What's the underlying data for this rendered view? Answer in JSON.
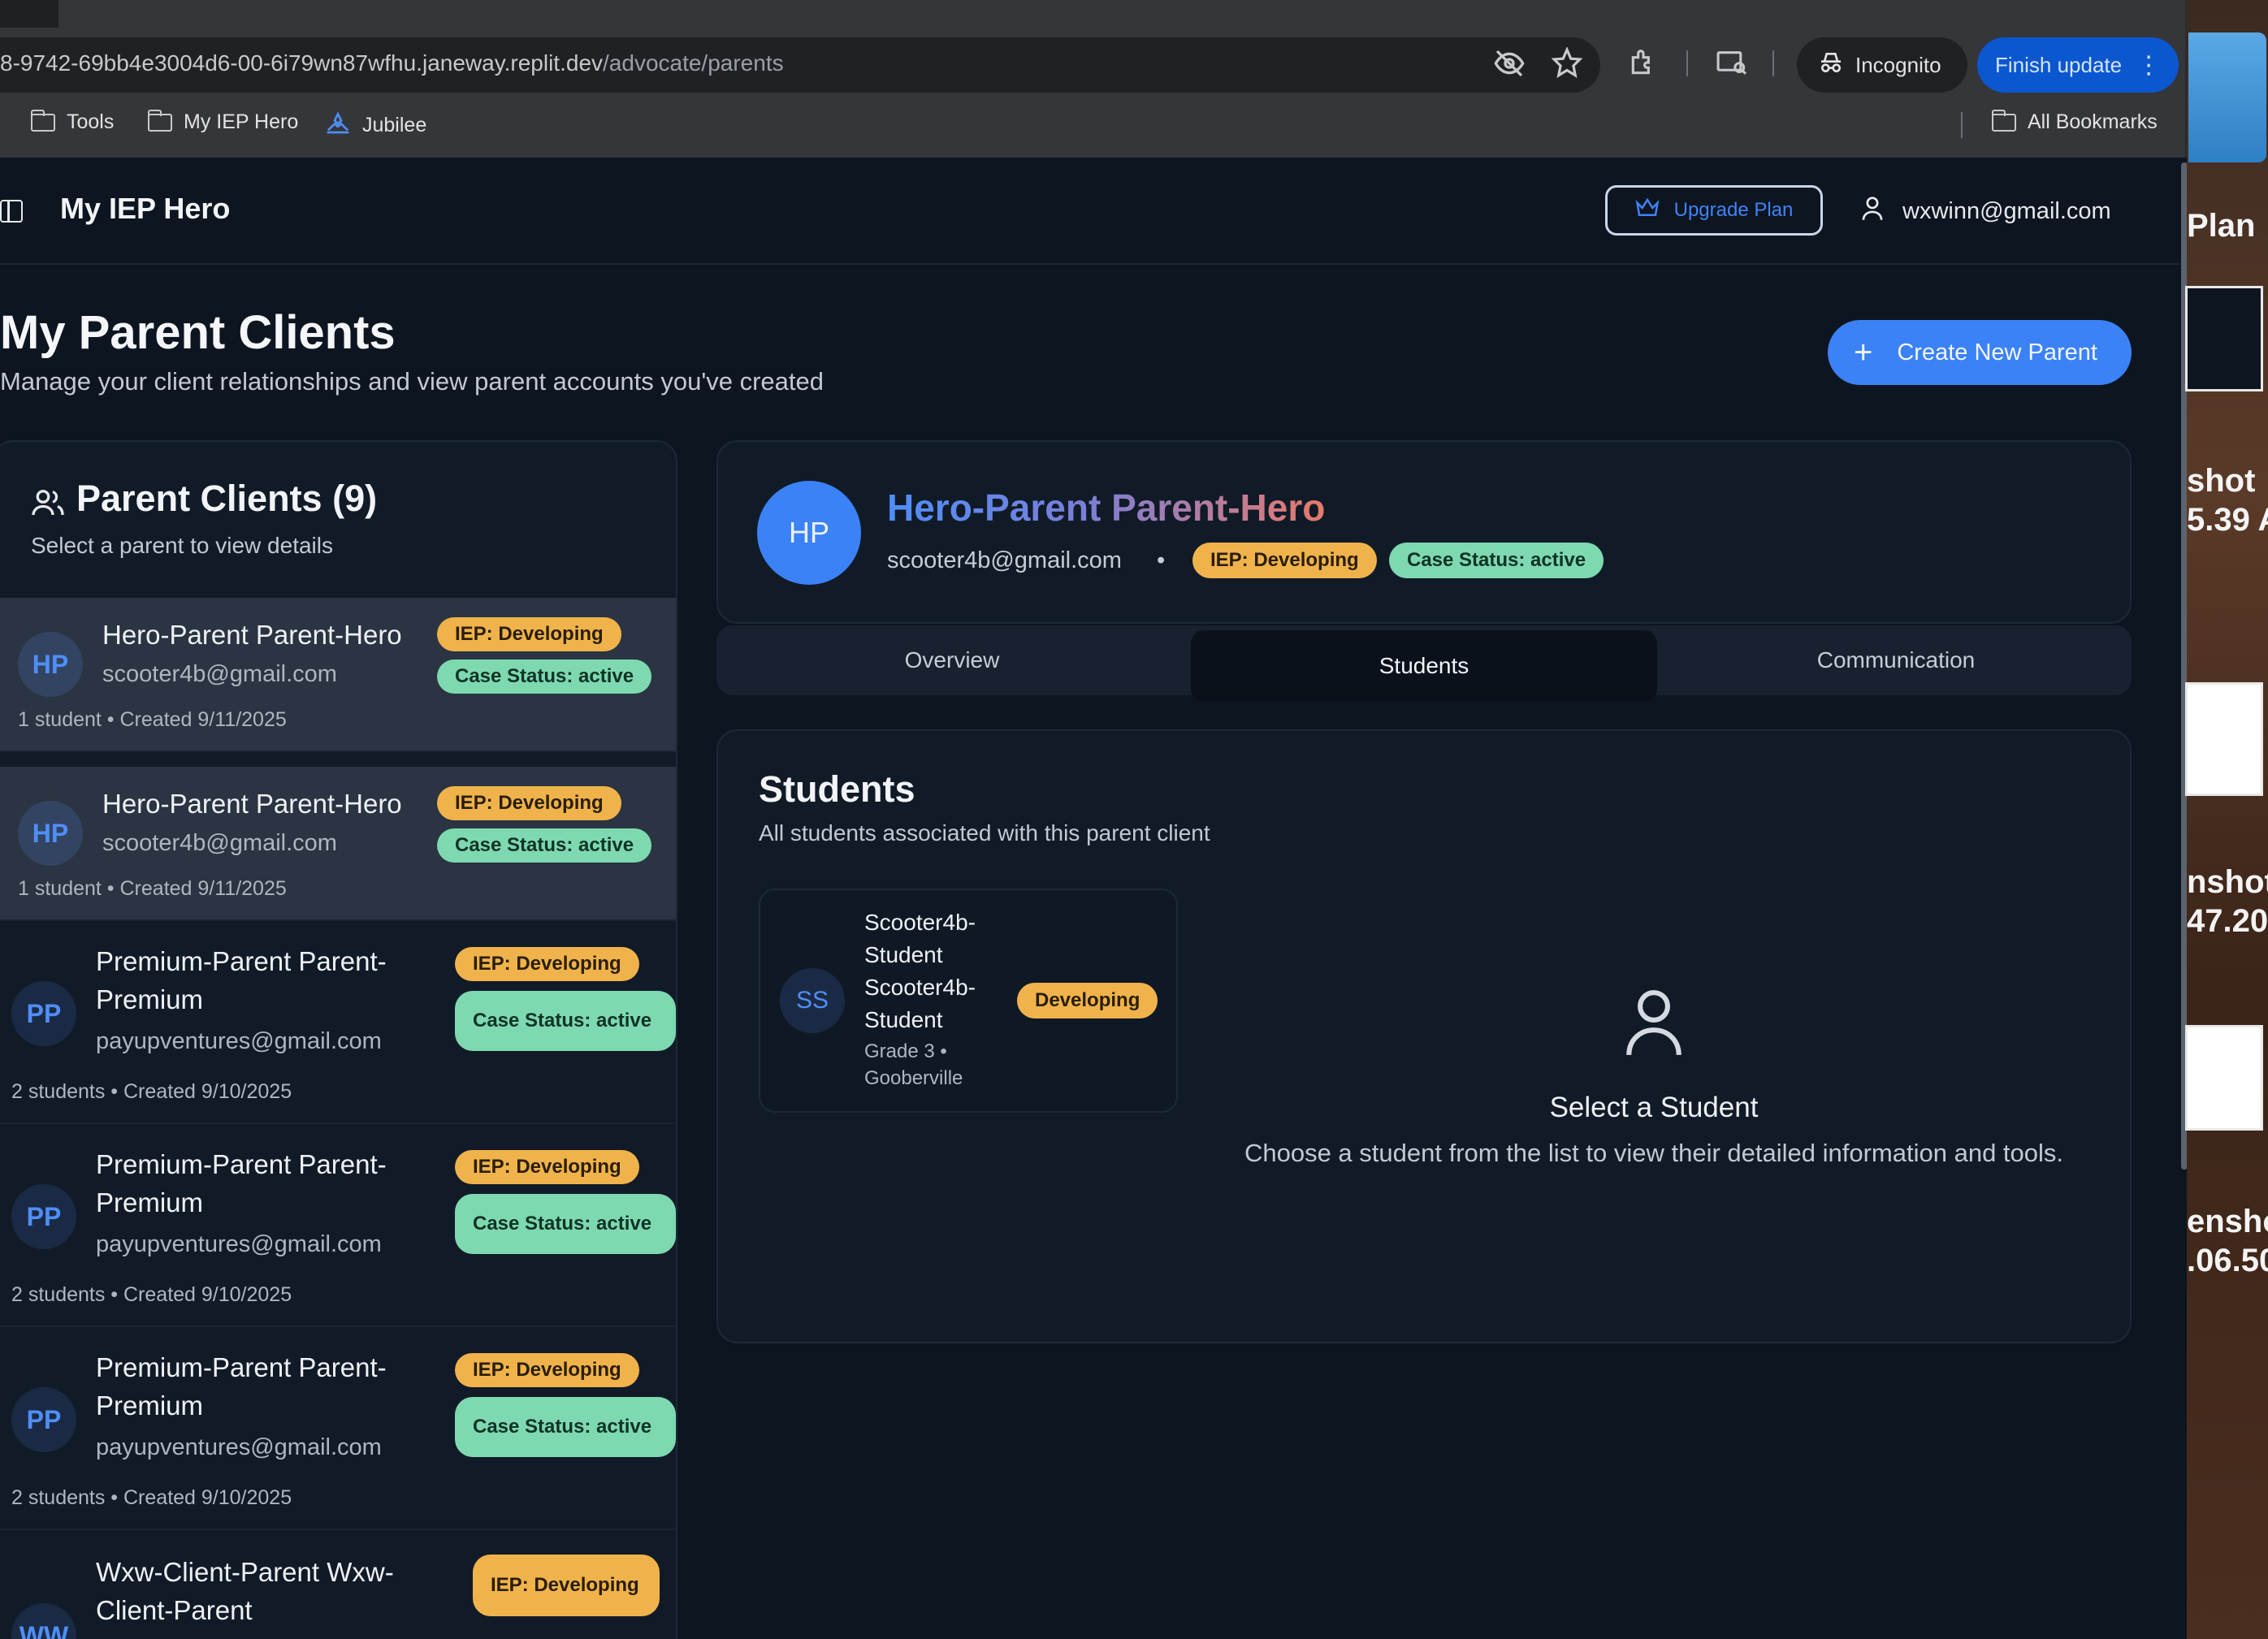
{
  "browser": {
    "url_host": "8-9742-69bb4e3004d6-00-6i79wn87wfhu.janeway.replit.dev",
    "url_path": "/advocate/parents",
    "incognito_label": "Incognito",
    "finish_update_label": "Finish update",
    "bookmarks": [
      "Tools",
      "My IEP Hero",
      "Jubilee"
    ],
    "all_bookmarks_label": "All Bookmarks"
  },
  "app": {
    "title": "My IEP Hero",
    "upgrade_label": "Upgrade Plan",
    "user_email": "wxwinn@gmail.com"
  },
  "page": {
    "heading": "My Parent Clients",
    "subheading": "Manage your client relationships and view parent accounts you've created",
    "create_button": "Create New Parent"
  },
  "clients_panel": {
    "title": "Parent Clients (9)",
    "subtitle": "Select a parent to view details",
    "clients": [
      {
        "initials": "HP",
        "name": "Hero-Parent Parent-Hero",
        "email": "scooter4b@gmail.com",
        "iep": "IEP: Developing",
        "case": "Case Status: active",
        "meta": "1 student • Created 9/11/2025"
      },
      {
        "initials": "HP",
        "name": "Hero-Parent Parent-Hero",
        "email": "scooter4b@gmail.com",
        "iep": "IEP: Developing",
        "case": "Case Status: active",
        "meta": "1 student • Created 9/11/2025"
      },
      {
        "initials": "PP",
        "name": "Premium-Parent Parent-Premium",
        "email": "payupventures@gmail.com",
        "iep": "IEP: Developing",
        "case": "Case Status: active",
        "meta": "2 students • Created 9/10/2025"
      },
      {
        "initials": "PP",
        "name": "Premium-Parent Parent-Premium",
        "email": "payupventures@gmail.com",
        "iep": "IEP: Developing",
        "case": "Case Status: active",
        "meta": "2 students • Created 9/10/2025"
      },
      {
        "initials": "PP",
        "name": "Premium-Parent Parent-Premium",
        "email": "payupventures@gmail.com",
        "iep": "IEP: Developing",
        "case": "Case Status: active",
        "meta": "2 students • Created 9/10/2025"
      },
      {
        "initials": "WW",
        "name": "Wxw-Client-Parent Wxw-Client-Parent",
        "iep": "IEP: Developing"
      }
    ]
  },
  "detail": {
    "initials": "HP",
    "name": "Hero-Parent Parent-Hero",
    "email": "scooter4b@gmail.com",
    "separator": "•",
    "iep": "IEP: Developing",
    "case": "Case Status: active",
    "tabs": [
      "Overview",
      "Students",
      "Communication"
    ],
    "active_tab": "Students"
  },
  "students": {
    "title": "Students",
    "subtitle": "All students associated with this parent client",
    "items": [
      {
        "initials": "SS",
        "name": "Scooter4b-Student Scooter4b-Student",
        "grade": "Grade 3 • Gooberville",
        "status": "Developing"
      }
    ],
    "empty_title": "Select a Student",
    "empty_text": "Choose a student from the list to view their detailed information and tools."
  },
  "desktop_labels": [
    "Plan",
    "shot",
    "5.39 A",
    "nshot",
    "47.20",
    "enshot",
    ".06.50"
  ],
  "colors": {
    "accent": "#3b82f6",
    "iep_badge": "#f0b34b",
    "case_badge": "#7ed9b0",
    "background": "#0d1520"
  }
}
